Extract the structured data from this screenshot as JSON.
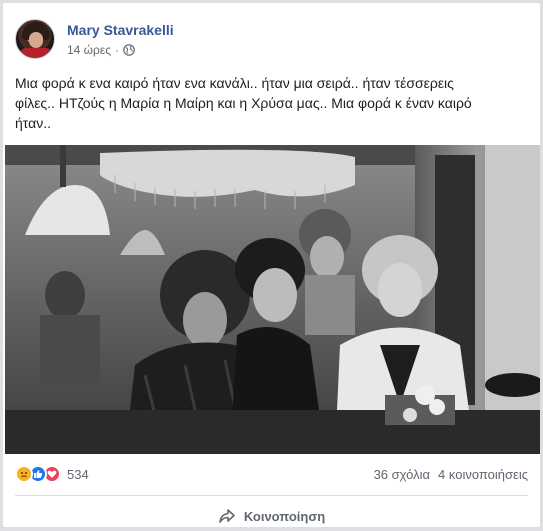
{
  "post": {
    "author": "Mary Stavrakelli",
    "time": "14 ώρες",
    "separator": "·",
    "privacy_icon": "globe-icon",
    "text_lines": [
      "Μια φορά κ ενα καιρό ήταν ενα κανάλι.. ήταν μια σειρά.. ήταν τέσσερεις",
      "φίλες.. ΗΤζούς η Μαρία η Μαίρη και η Χρύσα μας.. Μια φορά κ έναν καιρό",
      "ήταν.."
    ]
  },
  "reactions": {
    "icons": [
      "sad-icon",
      "like-icon",
      "love-icon"
    ],
    "count": "534",
    "comments": "36 σχόλια",
    "shares": "4 κοινοποιήσεις"
  },
  "actions": {
    "share_label": "Κοινοποίηση"
  },
  "colors": {
    "author": "#385898",
    "like": "#1877f2",
    "love": "#f33e58",
    "sad": "#f7b125"
  }
}
